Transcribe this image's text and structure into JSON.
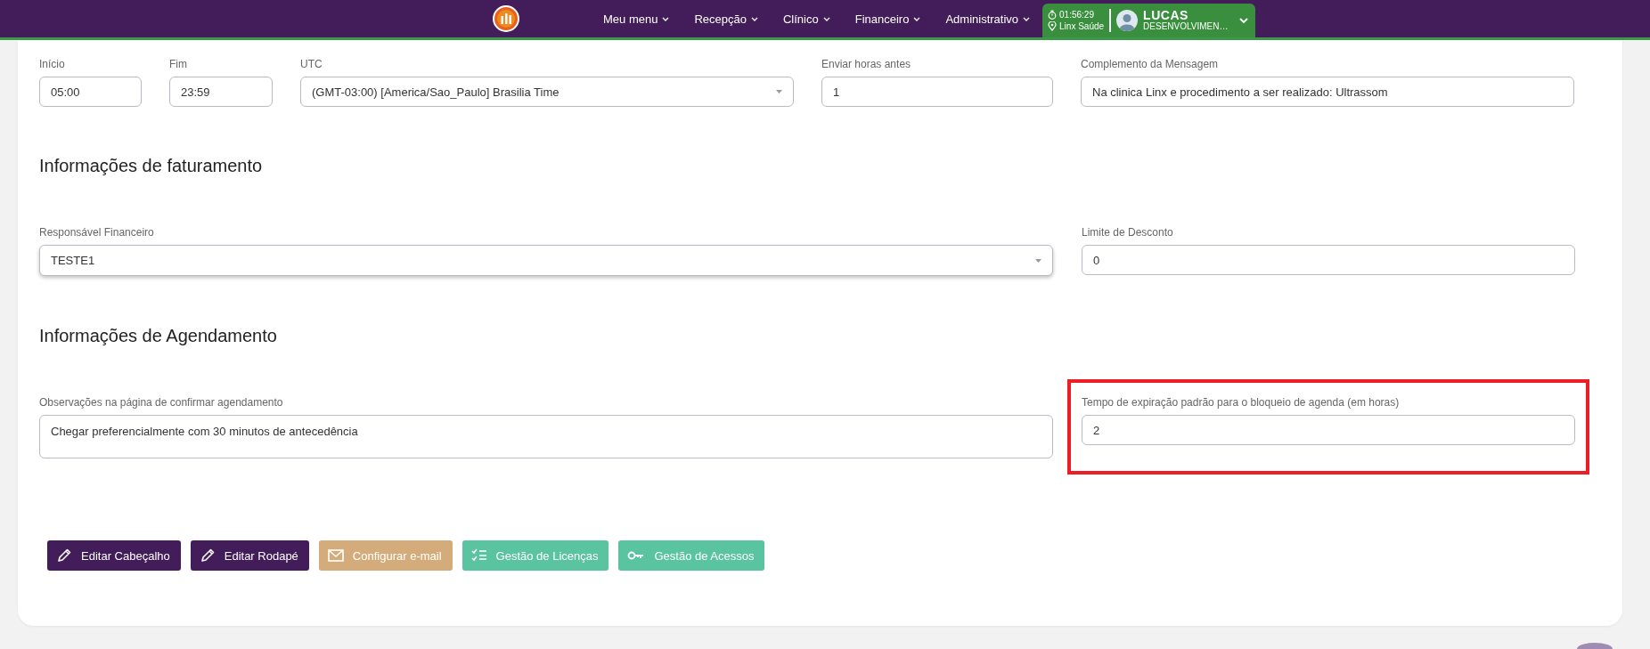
{
  "nav": {
    "menu": [
      {
        "label": "Meu menu"
      },
      {
        "label": "Recepção"
      },
      {
        "label": "Clínico"
      },
      {
        "label": "Financeiro"
      },
      {
        "label": "Administrativo"
      }
    ],
    "session": {
      "time": "01:56:29",
      "location": "Linx Saúde",
      "user": "LUCAS",
      "role": "DESENVOLVIMEN…"
    }
  },
  "sections": [
    {
      "fields": [
        {
          "kind": "text",
          "label": "Início",
          "value": "05:00",
          "highlighted": false
        },
        {
          "kind": "text",
          "label": "Fim",
          "value": "23:59",
          "highlighted": false
        },
        {
          "kind": "select",
          "label": "UTC",
          "value": "(GMT-03:00) [America/Sao_Paulo] Brasilia Time",
          "highlighted": false
        },
        {
          "kind": "text",
          "label": "Enviar horas antes",
          "value": "1",
          "highlighted": false
        },
        {
          "kind": "text",
          "label": "Complemento da Mensagem",
          "value": "Na clinica Linx e procedimento a ser realizado: Ultrassom",
          "highlighted": false
        }
      ]
    },
    {
      "title": "Informações de faturamento",
      "fields": [
        {
          "kind": "select",
          "label": "Responsável Financeiro",
          "value": "TESTE1",
          "highlighted": false
        },
        {
          "kind": "text",
          "label": "Limite de Desconto",
          "value": "0",
          "highlighted": false
        }
      ]
    },
    {
      "title": "Informações de Agendamento",
      "fields": [
        {
          "kind": "textarea",
          "label": "Observações na página de confirmar agendamento",
          "value": "Chegar preferencialmente com 30 minutos de antecedência",
          "highlighted": false
        },
        {
          "kind": "text",
          "label": "Tempo de expiração padrão para o bloqueio de agenda (em horas)",
          "value": "2",
          "highlighted": true
        }
      ]
    }
  ],
  "buttons": [
    {
      "kind": "pencil",
      "label": "Editar Cabeçalho",
      "color": "#431c5a"
    },
    {
      "kind": "pencil",
      "label": "Editar Rodapé",
      "color": "#431c5a"
    },
    {
      "kind": "mail",
      "label": "Configurar e-mail",
      "color": "#d4ab7a"
    },
    {
      "kind": "checklist",
      "label": "Gestão de Licenças",
      "color": "#5ac3a0"
    },
    {
      "kind": "key",
      "label": "Gestão de Acessos",
      "color": "#5ac3a0"
    }
  ]
}
